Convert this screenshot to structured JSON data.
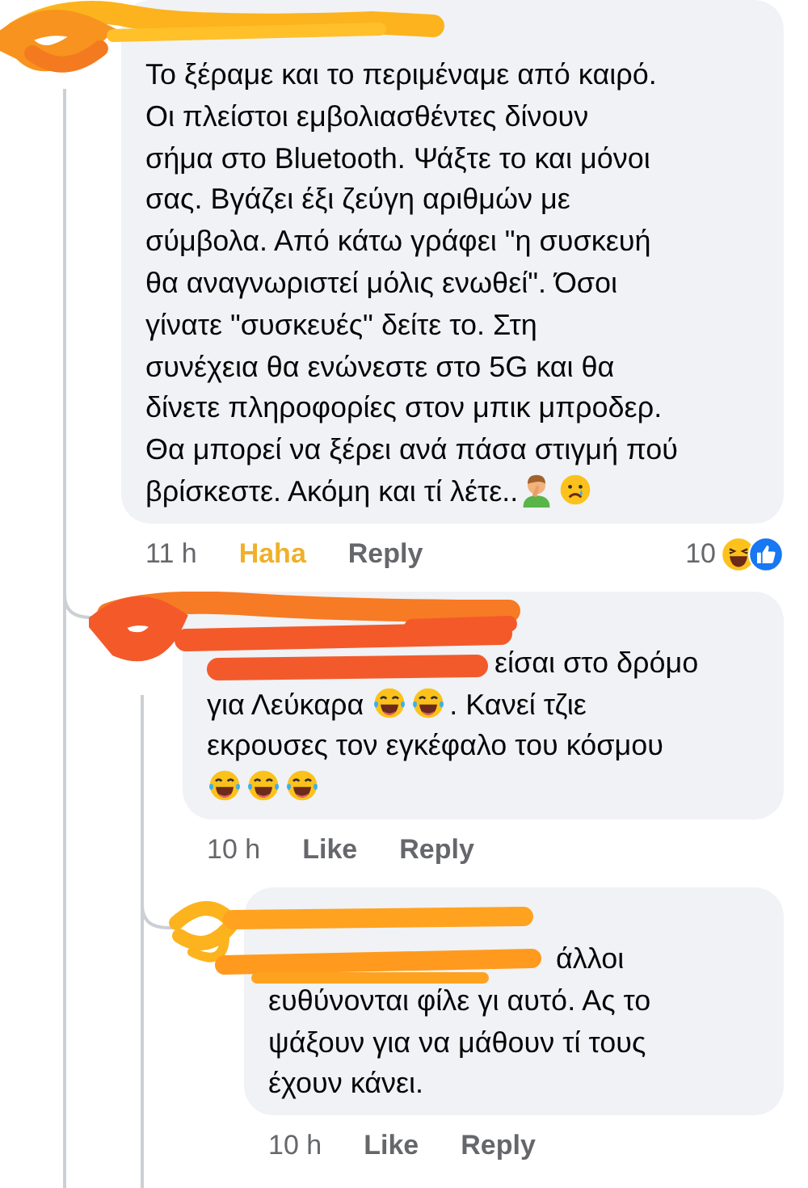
{
  "comments": [
    {
      "redacted": true,
      "body": [
        {
          "kind": "text",
          "text": "Το ξέραμε και το περιμέναμε από καιρό.\nΟι πλείστοι εμβολιασθέντες δίνουν\nσήμα στο Bluetooth. Ψάξτε το και μόνοι\nσας. Βγάζει έξι ζεύγη αριθμών με\nσύμβολα. Από κάτω γράφει \"η συσκευή\nθα αναγνωριστεί μόλις ενωθεί\". Όσοι\nγίνατε \"συσκευές\" δείτε το. Στη\nσυνέχεια θα ενώνεστε στο 5G και θα\nδίνετε πληροφορίες στον μπικ μπροδερ.\nΘα μπορεί να ξέρει ανά πάσα στιγμή πού\nβρίσκεστε. Ακόμη και τί λέτε.."
        },
        {
          "kind": "facepalm"
        },
        {
          "kind": "crying"
        }
      ],
      "time": "11 h",
      "like": {
        "label": "Haha",
        "reacted": true
      },
      "reply": "Reply",
      "reactions": {
        "count": "10",
        "types": [
          {
            "kind": "haha"
          },
          {
            "kind": "like"
          }
        ]
      },
      "replies": [
        {
          "redacted": true,
          "body": [
            {
              "kind": "text",
              "text": "είσαι στο δρόμο\nγια Λεύκαρα "
            },
            {
              "kind": "laughing"
            },
            {
              "kind": "laughing"
            },
            {
              "kind": "text",
              "text": ". Κανεί τζιε\nεκρουσες τον εγκέφαλο του κόσμου\n"
            },
            {
              "kind": "laughing"
            },
            {
              "kind": "laughing"
            },
            {
              "kind": "laughing"
            }
          ],
          "time": "10 h",
          "like": {
            "label": "Like",
            "reacted": false
          },
          "reply": "Reply",
          "replies": [
            {
              "redacted": true,
              "body": [
                {
                  "kind": "text",
                  "text": "άλλοι\nευθύνονται φίλε γι αυτό. Ας το\nψάξουν για να μάθουν τί τους\nέχουν κάνει."
                }
              ],
              "time": "10 h",
              "like": {
                "label": "Like",
                "reacted": false
              },
              "reply": "Reply"
            }
          ]
        }
      ]
    }
  ]
}
